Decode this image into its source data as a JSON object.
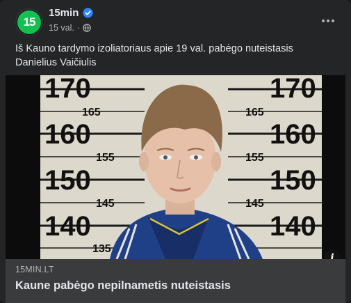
{
  "header": {
    "avatar_text": "15",
    "page_name": "15min",
    "verified": true,
    "time": "15 val.",
    "separator": "·",
    "privacy_icon": "globe-icon",
    "more_icon": "more-options-icon"
  },
  "post": {
    "text": "Iš Kauno tardymo izoliatoriaus apie 19 val. pabėgo nuteistasis Danielius Vaičiulis"
  },
  "media": {
    "ruler_labels": [
      "170",
      "165",
      "160",
      "155",
      "150",
      "145",
      "140",
      "135"
    ],
    "info_icon": "i"
  },
  "link_preview": {
    "domain": "15MIN.LT",
    "title": "Kaune pabėgo nepilnametis nuteistasis"
  },
  "colors": {
    "brand_green": "#12c052",
    "verified_blue": "#2d88ff",
    "card_bg": "#242526",
    "preview_bg": "#3a3b3c"
  }
}
